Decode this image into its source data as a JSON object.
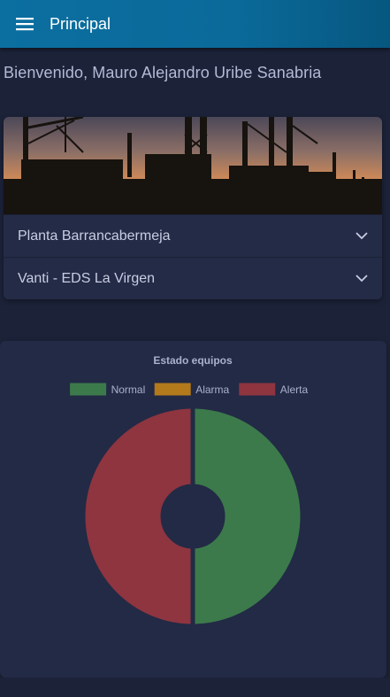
{
  "app": {
    "title": "Principal"
  },
  "welcome": "Bienvenido, Mauro Alejandro Uribe Sanabria",
  "plants": [
    {
      "label": "Planta Barrancabermeja"
    },
    {
      "label": "Vanti - EDS La Virgen"
    }
  ],
  "icons": {
    "menu": "hamburger-menu-icon",
    "expand": "chevron-down-icon"
  },
  "colors": {
    "header": "#0b6fa0",
    "background": "#1c2238",
    "card": "#232b46",
    "normal": "#3c7a4b",
    "alarma": "#b37a1c",
    "alerta": "#8e3540"
  },
  "chart_data": {
    "type": "pie",
    "title": "Estado equipos",
    "legend_position": "top",
    "donut": true,
    "categories": [
      "Normal",
      "Alarma",
      "Alerta"
    ],
    "values": [
      50,
      0,
      50
    ],
    "colors": [
      "#3c7a4b",
      "#b37a1c",
      "#8e3540"
    ]
  }
}
